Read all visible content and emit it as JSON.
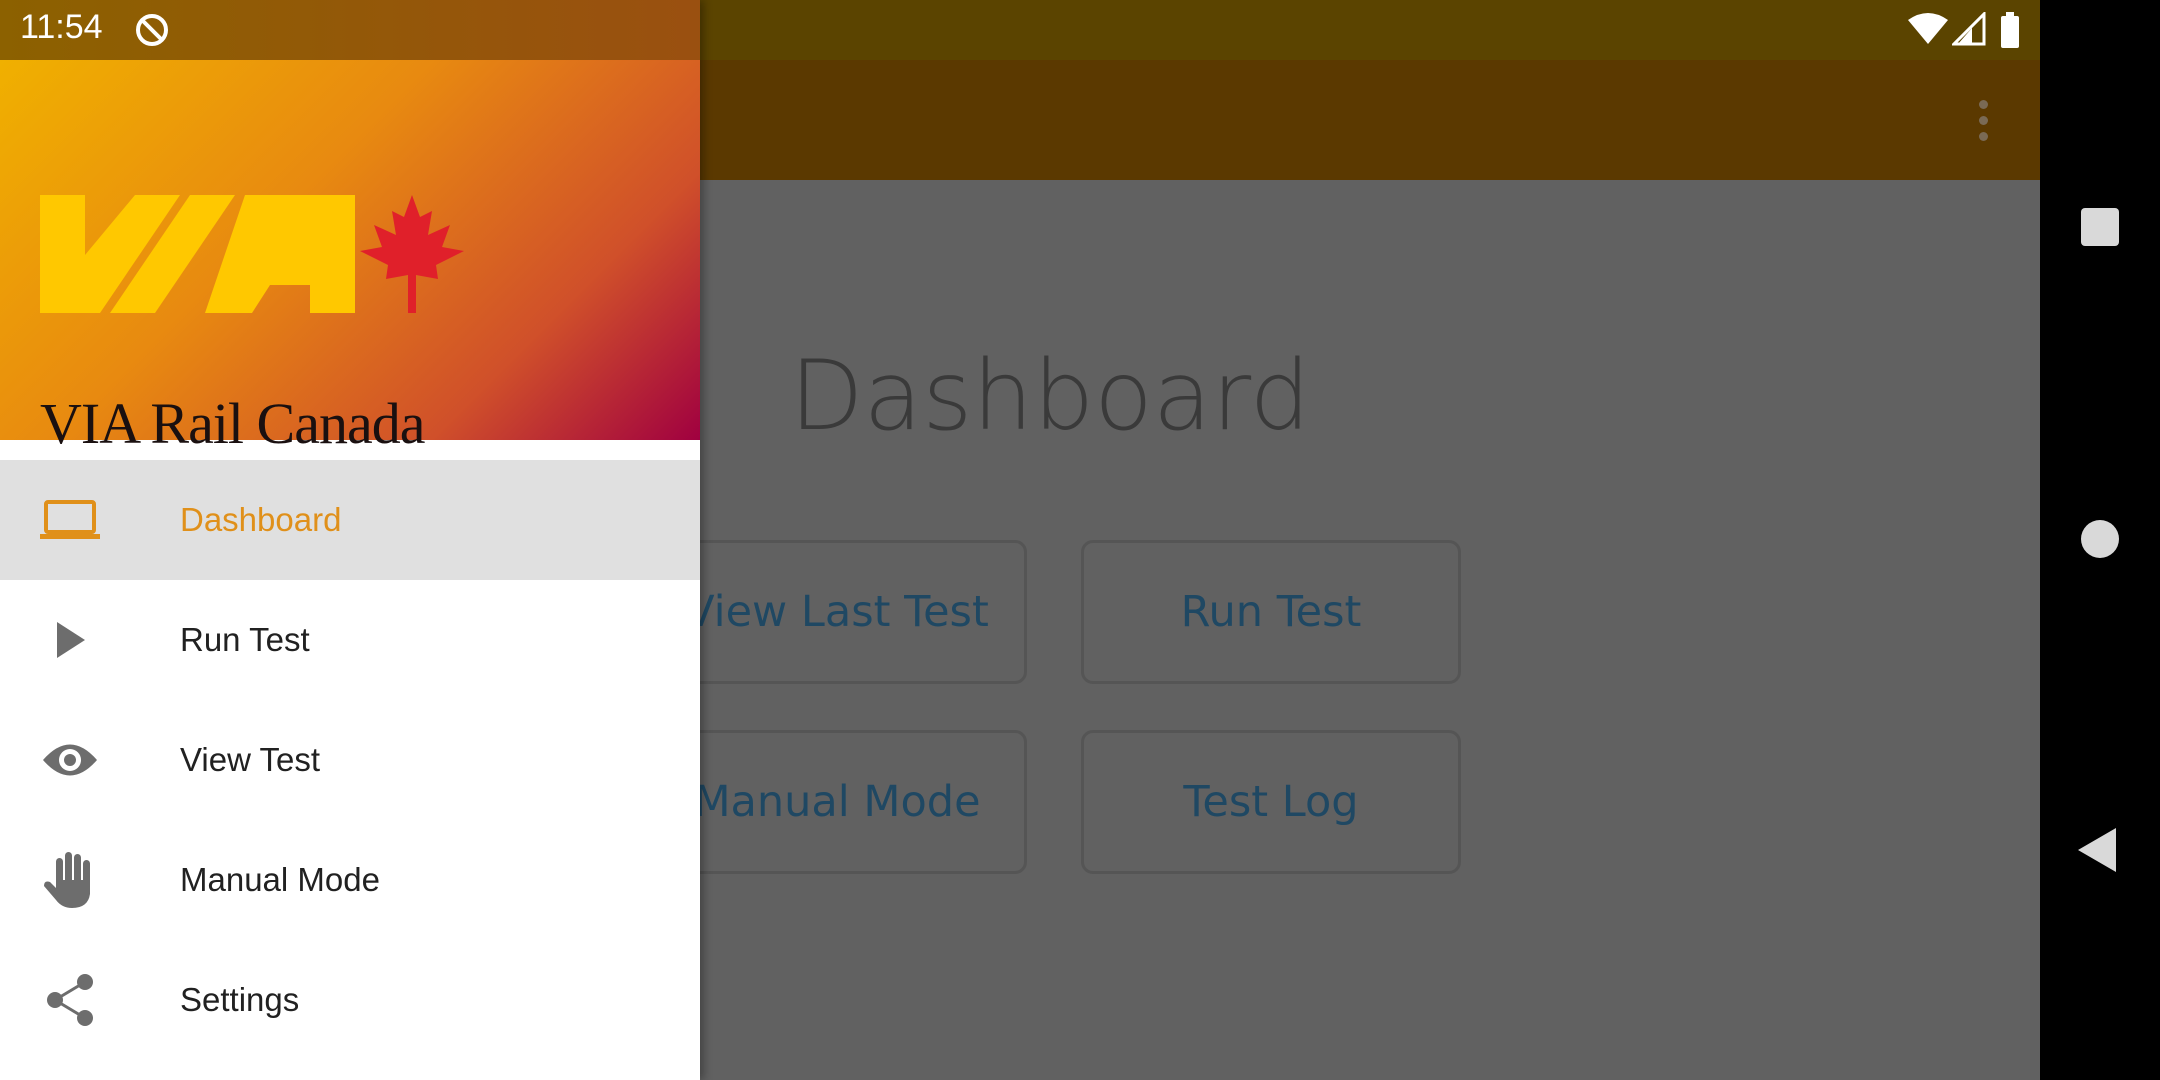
{
  "status_bar": {
    "time": "11:54"
  },
  "app": {
    "page_title": "Dashboard",
    "buttons": {
      "view_last_test": "View Last Test",
      "run_test": "Run Test",
      "manual_mode": "Manual Mode",
      "test_log": "Test Log"
    }
  },
  "drawer": {
    "brand": "VIA Rail Canada",
    "items": [
      {
        "label": "Dashboard",
        "icon": "laptop-icon",
        "active": true
      },
      {
        "label": "Run Test",
        "icon": "play-icon"
      },
      {
        "label": "View Test",
        "icon": "eye-icon"
      },
      {
        "label": "Manual Mode",
        "icon": "hand-icon"
      },
      {
        "label": "Settings",
        "icon": "share-icon"
      }
    ]
  },
  "colors": {
    "accent": "#e0901a",
    "button_text": "#1f4863",
    "header_gradient": [
      "#f0b000",
      "#e88a10",
      "#d0502a",
      "#a00040"
    ]
  }
}
